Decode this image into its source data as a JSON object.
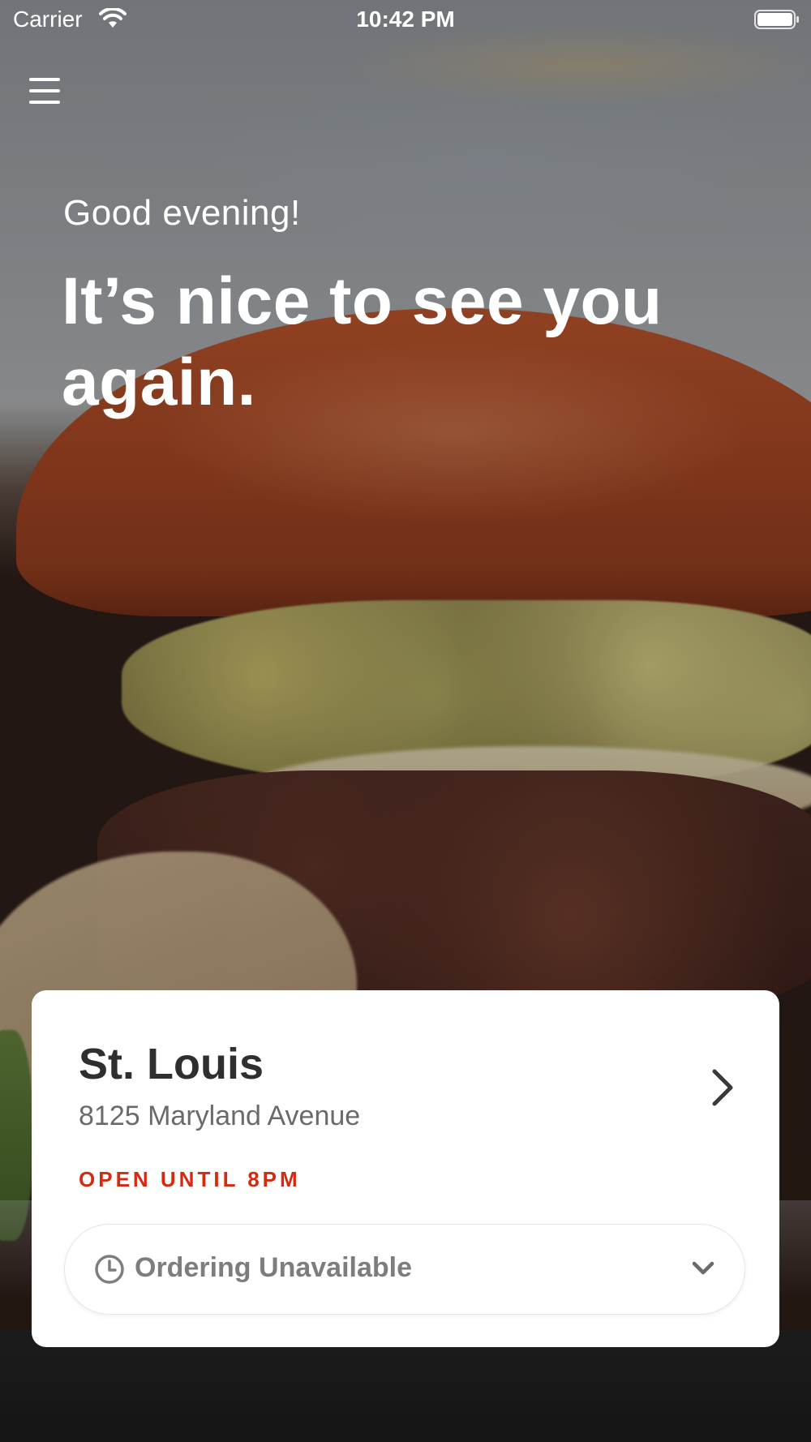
{
  "status_bar": {
    "carrier": "Carrier",
    "time": "10:42 PM",
    "wifi_icon": "wifi-icon",
    "battery_icon": "battery-icon"
  },
  "header": {
    "menu_icon": "hamburger-menu-icon"
  },
  "greeting": {
    "subtitle": "Good evening!",
    "headline": "It’s nice to see you again."
  },
  "location": {
    "name": "St. Louis",
    "address": "8125 Maryland Avenue",
    "status": "OPEN UNTIL 8PM",
    "status_color": "#d42a12",
    "chevron_icon": "chevron-right-icon"
  },
  "ordering": {
    "label": "Ordering Unavailable",
    "clock_icon": "clock-icon",
    "dropdown_icon": "chevron-down-icon"
  }
}
